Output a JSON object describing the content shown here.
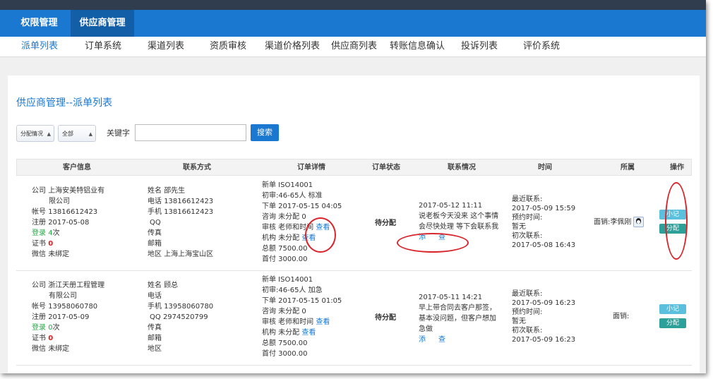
{
  "nav": {
    "top": [
      {
        "label": "权限管理",
        "active": false
      },
      {
        "label": "供应商管理",
        "active": true
      }
    ],
    "sub": [
      {
        "label": "派单列表",
        "active": true
      },
      {
        "label": "订单系统",
        "active": false
      },
      {
        "label": "渠道列表",
        "active": false
      },
      {
        "label": "资质审核",
        "active": false
      },
      {
        "label": "渠道价格列表",
        "active": false
      },
      {
        "label": "供应商列表",
        "active": false
      },
      {
        "label": "转账信息确认",
        "active": false
      },
      {
        "label": "投诉列表",
        "active": false
      },
      {
        "label": "评价系统",
        "active": false
      }
    ]
  },
  "page": {
    "title": "供应商管理--派单列表"
  },
  "filters": {
    "assign_select": "分配情况",
    "all_select": "全部",
    "keyword_label": "关键字",
    "keyword_value": "",
    "search_label": "搜索"
  },
  "table": {
    "headers": [
      "客户信息",
      "联系方式",
      "订单详情",
      "订单状态",
      "联系情况",
      "时间",
      "所属",
      "操作"
    ],
    "rows": [
      {
        "customer": {
          "company_label": "公司",
          "company_line1": "上海安美特铝业有",
          "company_line2": "限公司",
          "account_label": "帐号",
          "account": "13816612423",
          "register_label": "注册",
          "register": "2017-05-08",
          "login_label": "登录",
          "login_count": "4",
          "login_suffix": "次",
          "cert_label": "证书",
          "cert": "0",
          "wechat_label": "微信",
          "wechat": "未绑定"
        },
        "contact": {
          "name_label": "姓名",
          "name": "邵先生",
          "phone_label": "电话",
          "phone": "13816612423",
          "mobile_label": "手机",
          "mobile": "13816612423",
          "qq_label": "QQ",
          "qq": "",
          "fax_label": "传真",
          "fax": "",
          "email_label": "邮箱",
          "email": "",
          "region_label": "地区",
          "region": "上海上海宝山区"
        },
        "order": {
          "line1": "新单 ISO14001",
          "line2": "初审:46-65人 标准",
          "line3": "下单 2017-05-15 04:05",
          "line4": "咨询 未分配 0",
          "line5": "审核 老师和时间",
          "line6": "机构 未分配",
          "view_label": "查看",
          "line7": "总额 7500.00",
          "line8": "首付 3000.00"
        },
        "status": "待分配",
        "contact_log": {
          "time": "2017-05-12 11:11",
          "line1": "说老板今天没来 这个事情",
          "line2": "会尽快处理 等下会联系我",
          "line3": "",
          "add_label": "添",
          "view_label": "查"
        },
        "time": {
          "last_label": "最近联系:",
          "last": "2017-05-09 15:59",
          "appt_label": "预约时间:",
          "appt": "暂无",
          "first_label": "初次联系:",
          "first": "2017-05-08 16:43"
        },
        "owner": "面销:李佩刚",
        "note_label": "小记",
        "assign_label": "分配"
      },
      {
        "customer": {
          "company_label": "公司",
          "company_line1": "浙江天册工程管理",
          "company_line2": "有限公司",
          "account_label": "帐号",
          "account": "13958060780",
          "register_label": "注册",
          "register": "2017-05-09",
          "login_label": "登录",
          "login_count": "0",
          "login_suffix": "次",
          "cert_label": "证书",
          "cert": "0",
          "wechat_label": "微信",
          "wechat": "未绑定"
        },
        "contact": {
          "name_label": "姓名",
          "name": "顾总",
          "phone_label": "电话",
          "phone": "",
          "mobile_label": "手机",
          "mobile": "13958060780",
          "qq_label": "QQ",
          "qq": "2974520799",
          "fax_label": "传真",
          "fax": "",
          "email_label": "邮箱",
          "email": "",
          "region_label": "地区",
          "region": ""
        },
        "order": {
          "line1": "新单 ISO14001",
          "line2": "初审:46-65人 加急",
          "line3": "下单 2017-05-15 01:05",
          "line4": "咨询 未分配 0",
          "line5": "审核 老师和时间",
          "line6": "机构 未分配",
          "view_label": "查看",
          "line7": "总额 7500.00",
          "line8": "首付 3000.00"
        },
        "status": "待分配",
        "contact_log": {
          "time": "2017-05-11 14:21",
          "line1": "早上带合同去客户那签，",
          "line2": "基本没问题，但客户想加",
          "line3": "急做",
          "add_label": "添",
          "view_label": "查"
        },
        "time": {
          "last_label": "最近联系:",
          "last": "2017-05-09 16:23",
          "appt_label": "预约时间:",
          "appt": "暂无",
          "first_label": "初次联系:",
          "first": "2017-05-09 16:23"
        },
        "owner": "面销:",
        "note_label": "小记",
        "assign_label": "分配"
      }
    ]
  },
  "colors": {
    "primary": "#1a78d0",
    "annotation": "#d9262c",
    "note_button": "#5bc0de",
    "assign_button": "#2ea09a"
  }
}
